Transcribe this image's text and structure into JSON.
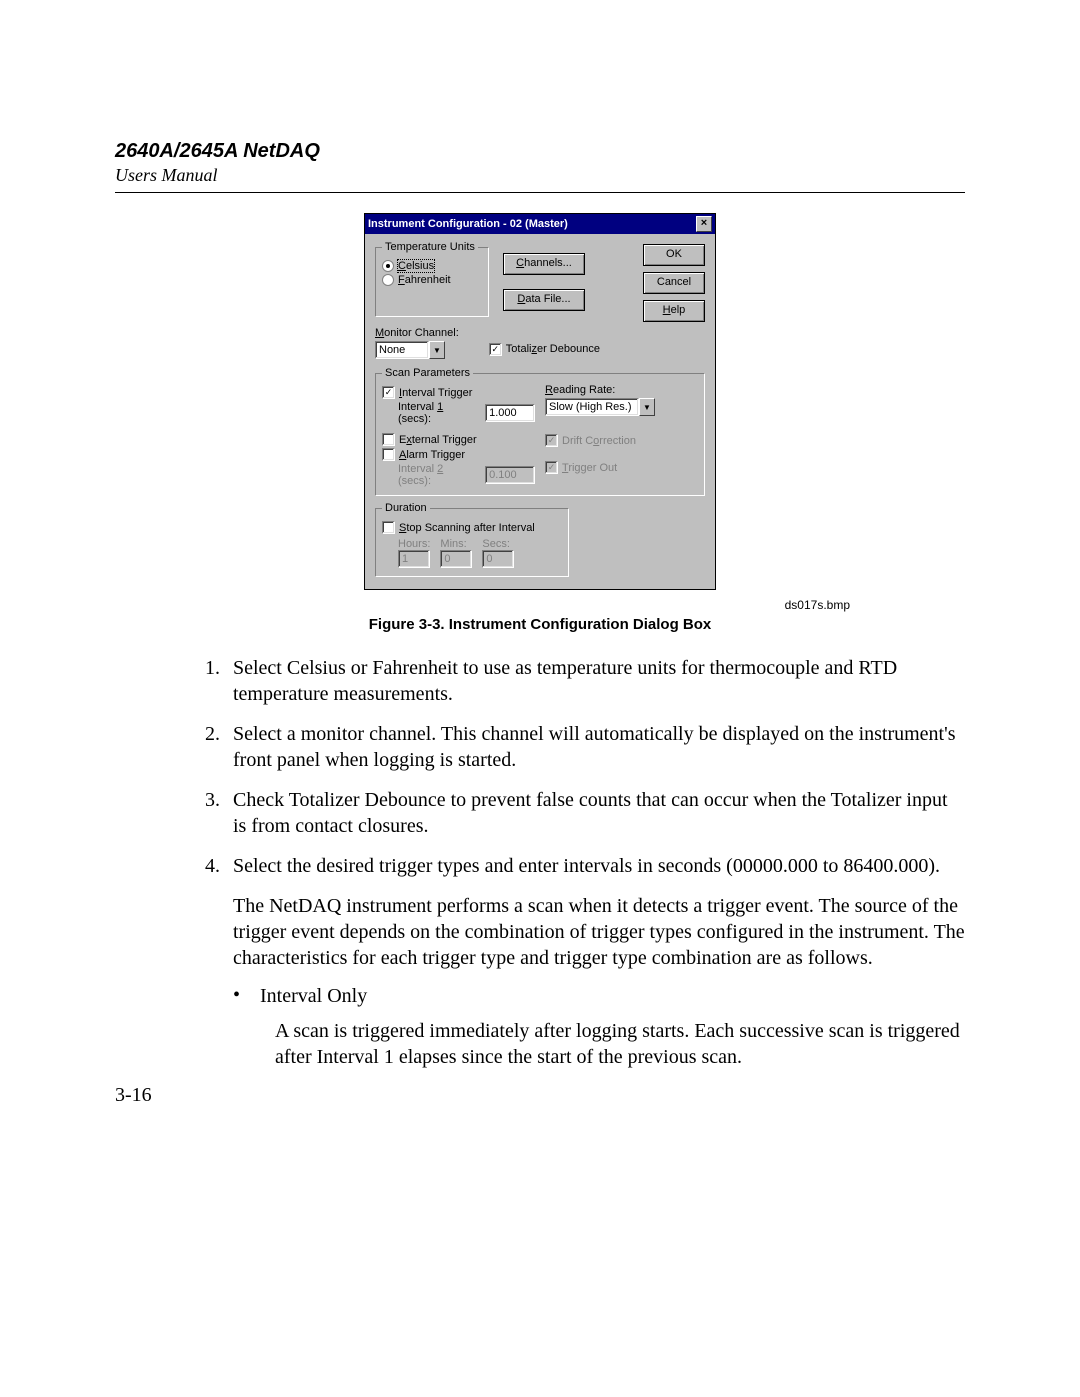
{
  "header": {
    "title": "2640A/2645A NetDAQ",
    "subtitle": "Users Manual"
  },
  "dialog": {
    "title": "Instrument Configuration - 02 (Master)",
    "close_glyph": "×",
    "temp_units_group": "Temperature Units",
    "radio_celsius": "Celsius",
    "radio_fahrenheit": "Fahrenheit",
    "channels_btn": "Channels...",
    "data_file_btn": "Data File...",
    "ok_btn": "OK",
    "cancel_btn": "Cancel",
    "help_btn": "Help",
    "monitor_label": "Monitor Channel:",
    "monitor_value": "None",
    "totalizer": "Totalizer Debounce",
    "scan_group": "Scan Parameters",
    "interval_trigger": "Interval Trigger",
    "interval1_label": "Interval 1 (secs):",
    "interval1_val": "1.000",
    "external_trigger": "External Trigger",
    "alarm_trigger": "Alarm Trigger",
    "interval2_label": "Interval 2 (secs):",
    "interval2_val": "0.100",
    "reading_rate_label": "Reading Rate:",
    "reading_rate_value": "Slow (High Res.)",
    "drift_correction": "Drift Correction",
    "trigger_out": "Trigger Out",
    "duration_group": "Duration",
    "stop_scan": "Stop Scanning after Interval",
    "hours_label": "Hours:",
    "mins_label": "Mins:",
    "secs_label": "Secs:",
    "hours_val": "1",
    "mins_val": "0",
    "secs_val": "0"
  },
  "image_tag": "ds017s.bmp",
  "figure_caption": "Figure 3-3. Instrument Configuration Dialog Box",
  "list": {
    "i1": "Select Celsius or Fahrenheit to use as temperature units for thermocouple and RTD temperature measurements.",
    "i2": "Select a monitor channel. This channel will automatically be displayed on the instrument's front panel when logging is started.",
    "i3": "Check Totalizer Debounce to prevent false counts that can occur when the Totalizer input is from contact closures.",
    "i4": "Select the desired trigger types and enter intervals in seconds (00000.000 to 86400.000)."
  },
  "para_after": "The NetDAQ instrument performs a scan when it detects a trigger event. The source of the trigger event depends on the combination of trigger types configured in the instrument. The characteristics for each trigger type and trigger type combination are as follows.",
  "bullet_label": "Interval Only",
  "bullet_body": "A scan is triggered immediately after logging starts. Each successive scan is triggered after Interval 1 elapses since the start of the previous scan.",
  "page_number": "3-16"
}
